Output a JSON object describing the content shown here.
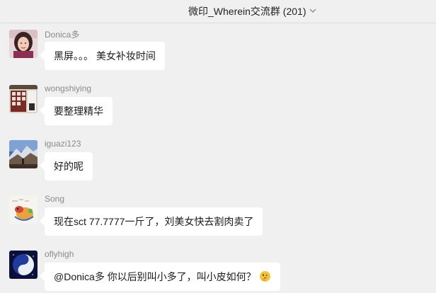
{
  "header": {
    "title": "微印_Wherein交流群 (201)"
  },
  "messages": [
    {
      "sender": "Donica多",
      "text": "黑屏。。。 美女补妆时间",
      "avatar_icon": "woman-photo-avatar"
    },
    {
      "sender": "wongshiying",
      "text": "要整理精华",
      "avatar_icon": "shelf-photo-avatar"
    },
    {
      "sender": "iguazi123",
      "text": "好的呢",
      "avatar_icon": "mountain-photo-avatar"
    },
    {
      "sender": "Song",
      "text": "现在sct 77.7777一斤了，刘美女快去割肉卖了",
      "avatar_icon": "cartoon-avatar"
    },
    {
      "sender": "oflyhigh",
      "text": "@Donica多 你以后别叫小多了，叫小皮如何？",
      "avatar_icon": "galaxy-avatar",
      "emoji": "thinking-face-emoji"
    }
  ],
  "colors": {
    "background": "#f0f0f0",
    "bubble": "#ffffff",
    "sender_name": "#8a8a8a",
    "text": "#1a1a1a"
  }
}
